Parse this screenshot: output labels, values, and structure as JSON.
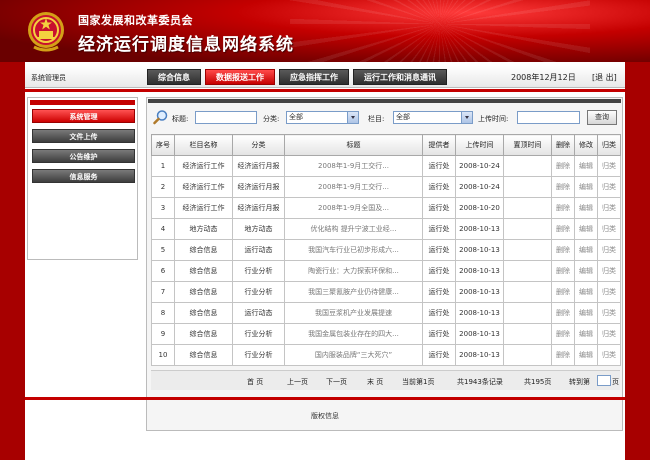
{
  "header": {
    "org_name": "国家发展和改革委员会",
    "system_name": "经济运行调度信息网络系统"
  },
  "navbar": {
    "admin_label": "系统管理员",
    "tabs": [
      {
        "label": "综合信息"
      },
      {
        "label": "数据报送工作"
      },
      {
        "label": "应急指挥工作"
      },
      {
        "label": "运行工作和消息通讯"
      }
    ],
    "active_tab": "数据报送工作",
    "date": "2008年12月12日",
    "logout": "[退 出]"
  },
  "sidebar": {
    "items": [
      {
        "label": "系统管理"
      },
      {
        "label": "文件上传"
      },
      {
        "label": "公告维护"
      },
      {
        "label": "信息服务"
      }
    ],
    "active_item": "系统管理"
  },
  "search": {
    "title_label": "标题:",
    "category_label": "分类:",
    "category_value": "全部",
    "column_label": "栏目:",
    "column_value": "全部",
    "upload_time_label": "上传时间:",
    "query_button": "查询"
  },
  "table": {
    "headers": [
      "序号",
      "栏目名称",
      "分类",
      "标题",
      "提供者",
      "上传时间",
      "置顶时间",
      "删除",
      "修改",
      "归类"
    ],
    "rows": [
      {
        "no": "1",
        "column": "经济运行工作",
        "category": "经济运行月报",
        "title": "2008年1-9月工交行...",
        "provider": "运行处",
        "upload": "2008-10-24",
        "top": "",
        "del": "删除",
        "edit": "编辑",
        "classify": "归类"
      },
      {
        "no": "2",
        "column": "经济运行工作",
        "category": "经济运行月报",
        "title": "2008年1-9月工交行...",
        "provider": "运行处",
        "upload": "2008-10-24",
        "top": "",
        "del": "删除",
        "edit": "编辑",
        "classify": "归类"
      },
      {
        "no": "3",
        "column": "经济运行工作",
        "category": "经济运行月报",
        "title": "2008年1-9月全国及...",
        "provider": "运行处",
        "upload": "2008-10-20",
        "top": "",
        "del": "删除",
        "edit": "编辑",
        "classify": "归类"
      },
      {
        "no": "4",
        "column": "地方动态",
        "category": "地方动态",
        "title": "优化结构 提升宁波工业经...",
        "provider": "运行处",
        "upload": "2008-10-13",
        "top": "",
        "del": "删除",
        "edit": "编辑",
        "classify": "归类"
      },
      {
        "no": "5",
        "column": "综合信息",
        "category": "运行动态",
        "title": "我国汽车行业已初步形成六...",
        "provider": "运行处",
        "upload": "2008-10-13",
        "top": "",
        "del": "删除",
        "edit": "编辑",
        "classify": "归类"
      },
      {
        "no": "6",
        "column": "综合信息",
        "category": "行业分析",
        "title": "陶瓷行业：大力探索环保和...",
        "provider": "运行处",
        "upload": "2008-10-13",
        "top": "",
        "del": "删除",
        "edit": "编辑",
        "classify": "归类"
      },
      {
        "no": "7",
        "column": "综合信息",
        "category": "行业分析",
        "title": "我国三聚氰胺产业仍待健康...",
        "provider": "运行处",
        "upload": "2008-10-13",
        "top": "",
        "del": "删除",
        "edit": "编辑",
        "classify": "归类"
      },
      {
        "no": "8",
        "column": "综合信息",
        "category": "运行动态",
        "title": "我国豆浆机产业发展提速",
        "provider": "运行处",
        "upload": "2008-10-13",
        "top": "",
        "del": "删除",
        "edit": "编辑",
        "classify": "归类"
      },
      {
        "no": "9",
        "column": "综合信息",
        "category": "行业分析",
        "title": "我国金属包装业存在的四大...",
        "provider": "运行处",
        "upload": "2008-10-13",
        "top": "",
        "del": "删除",
        "edit": "编辑",
        "classify": "归类"
      },
      {
        "no": "10",
        "column": "综合信息",
        "category": "行业分析",
        "title": "国内服装品牌“三大死穴”",
        "provider": "运行处",
        "upload": "2008-10-13",
        "top": "",
        "del": "删除",
        "edit": "编辑",
        "classify": "归类"
      }
    ]
  },
  "pager": {
    "first": "首 页",
    "prev": "上一页",
    "next": "下一页",
    "last": "末 页",
    "current": "当前第1页",
    "total_records": "共1943条记录",
    "total_pages": "共195页",
    "goto_prefix": "转到第",
    "goto_suffix": "页"
  },
  "footer": {
    "copyright": "版权信息"
  },
  "colors": {
    "brand_red": "#c40000",
    "tab_dark": "#3e3e3e",
    "background": "#a70000"
  },
  "icons": [
    "national-emblem-icon",
    "magnifier-icon",
    "dropdown-arrow-icon"
  ]
}
